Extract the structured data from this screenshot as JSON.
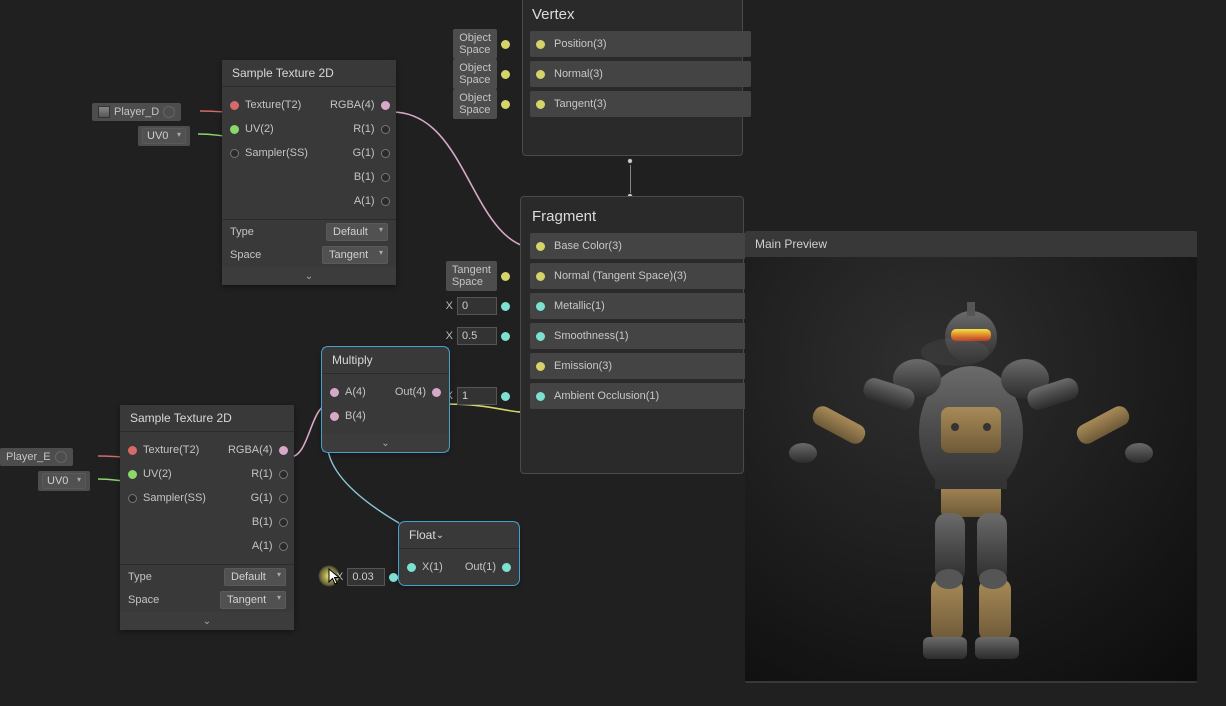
{
  "vertex": {
    "title": "Vertex",
    "slots": [
      {
        "label": "Position(3)",
        "chip": "Object Space"
      },
      {
        "label": "Normal(3)",
        "chip": "Object Space"
      },
      {
        "label": "Tangent(3)",
        "chip": "Object Space"
      }
    ]
  },
  "fragment": {
    "title": "Fragment",
    "slots": [
      {
        "label": "Base Color(3)",
        "chip": null,
        "value": null
      },
      {
        "label": "Normal (Tangent Space)(3)",
        "chip": "Tangent Space",
        "value": null
      },
      {
        "label": "Metallic(1)",
        "chip": null,
        "xlabel": "X",
        "value": "0"
      },
      {
        "label": "Smoothness(1)",
        "chip": null,
        "xlabel": "X",
        "value": "0.5"
      },
      {
        "label": "Emission(3)",
        "chip": null,
        "value": null
      },
      {
        "label": "Ambient Occlusion(1)",
        "chip": null,
        "xlabel": "X",
        "value": "1"
      }
    ]
  },
  "sample1": {
    "title": "Sample Texture 2D",
    "inputs": [
      "Texture(T2)",
      "UV(2)",
      "Sampler(SS)"
    ],
    "outputs": [
      "RGBA(4)",
      "R(1)",
      "G(1)",
      "B(1)",
      "A(1)"
    ],
    "props": {
      "type_label": "Type",
      "type_value": "Default",
      "space_label": "Space",
      "space_value": "Tangent"
    },
    "param_name": "Player_D",
    "uv_value": "UV0"
  },
  "sample2": {
    "title": "Sample Texture 2D",
    "inputs": [
      "Texture(T2)",
      "UV(2)",
      "Sampler(SS)"
    ],
    "outputs": [
      "RGBA(4)",
      "R(1)",
      "G(1)",
      "B(1)",
      "A(1)"
    ],
    "props": {
      "type_label": "Type",
      "type_value": "Default",
      "space_label": "Space",
      "space_value": "Tangent"
    },
    "param_name": "Player_E",
    "uv_value": "UV0"
  },
  "multiply": {
    "title": "Multiply",
    "inputs": [
      "A(4)",
      "B(4)"
    ],
    "outputs": [
      "Out(4)"
    ]
  },
  "floatNode": {
    "title": "Float",
    "input": "X(1)",
    "output": "Out(1)",
    "x_value": "0.03"
  },
  "preview": {
    "title": "Main Preview"
  }
}
